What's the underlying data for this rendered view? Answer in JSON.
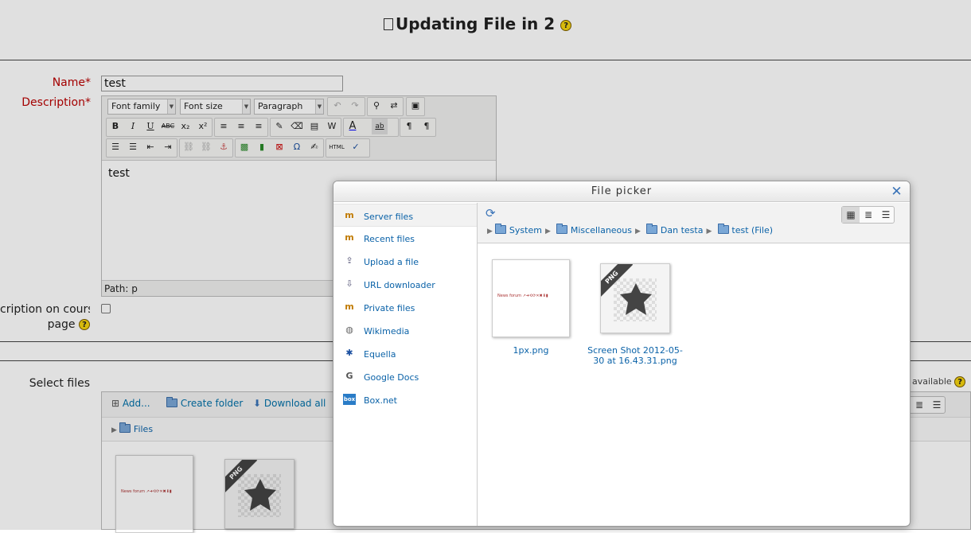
{
  "page": {
    "title": "Updating File in 2",
    "help_glyph": "?"
  },
  "form": {
    "name_label": "Name",
    "required_mark": "*",
    "name_value": "test",
    "description_label": "Description",
    "display_label_line1": "cription on course",
    "display_label_line2": "page",
    "select_files_label": "Select files",
    "available_text": "available"
  },
  "editor": {
    "font_family": "Font family",
    "font_size": "Font size",
    "format": "Paragraph",
    "content": "test",
    "path": "Path: p"
  },
  "filemanager": {
    "add": "Add...",
    "create_folder": "Create folder",
    "download_all": "Download all",
    "root_folder": "Files"
  },
  "thumbnail": {
    "mini_strip_text": "News forum ↗➜⟲⟳✕✖⬇▮"
  },
  "picker": {
    "title": "File picker",
    "repositories": [
      {
        "label": "Server files",
        "icon": "moodle-icon"
      },
      {
        "label": "Recent files",
        "icon": "moodle-icon"
      },
      {
        "label": "Upload a file",
        "icon": "upload-icon"
      },
      {
        "label": "URL downloader",
        "icon": "url-downloader-icon"
      },
      {
        "label": "Private files",
        "icon": "moodle-icon"
      },
      {
        "label": "Wikimedia",
        "icon": "wikimedia-icon"
      },
      {
        "label": "Equella",
        "icon": "equella-icon"
      },
      {
        "label": "Google Docs",
        "icon": "google-icon"
      },
      {
        "label": "Box.net",
        "icon": "boxnet-icon"
      }
    ],
    "breadcrumb": [
      "System",
      "Miscellaneous",
      "Dan testa",
      "test (File)"
    ],
    "files": [
      {
        "name": "1px.png"
      },
      {
        "name_line1": "Screen Shot 2012-05-",
        "name_line2": "30 at 16.43.31.png",
        "badge": "PNG"
      }
    ]
  },
  "colors": {
    "link": "#0a62a8",
    "required": "#bb0000",
    "help_icon": "#f5d40f"
  }
}
